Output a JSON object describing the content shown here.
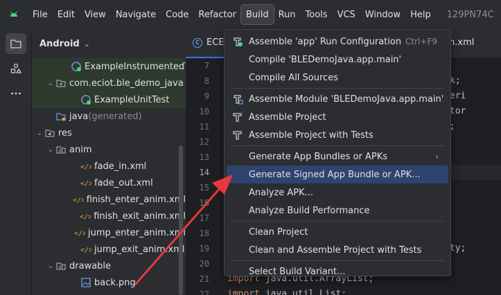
{
  "menubar": {
    "items": [
      "File",
      "Edit",
      "View",
      "Navigate",
      "Code",
      "Refactor",
      "Build",
      "Run",
      "Tools",
      "VCS",
      "Window",
      "Help"
    ],
    "active_index": 6,
    "project_name": "129PN74C"
  },
  "project_panel": {
    "title": "Android",
    "tree": [
      {
        "indent": 56,
        "arrow": "",
        "icon": "android-test-class-icon",
        "label": "ExampleInstrumentedT",
        "suffix": "",
        "hl": true
      },
      {
        "indent": 20,
        "arrow": "⌄",
        "icon": "package-icon",
        "label": "com.eciot.ble_demo_java",
        "suffix": "",
        "hl": true
      },
      {
        "indent": 56,
        "arrow": "",
        "icon": "android-test-class-icon",
        "label": "ExampleUnitTest",
        "suffix": "",
        "hl": true
      },
      {
        "indent": 20,
        "arrow": "",
        "icon": "folder-generated-icon",
        "label": "java",
        "suffix": " (generated)",
        "hl": false
      },
      {
        "indent": 4,
        "arrow": "⌄",
        "icon": "folder-res-icon",
        "label": "res",
        "suffix": "",
        "hl": false
      },
      {
        "indent": 20,
        "arrow": "⌄",
        "icon": "folder-icon",
        "label": "anim",
        "suffix": "",
        "hl": false
      },
      {
        "indent": 56,
        "arrow": "",
        "icon": "xml-file-icon",
        "label": "fade_in.xml",
        "suffix": "",
        "hl": false
      },
      {
        "indent": 56,
        "arrow": "",
        "icon": "xml-file-icon",
        "label": "fade_out.xml",
        "suffix": "",
        "hl": false
      },
      {
        "indent": 56,
        "arrow": "",
        "icon": "xml-file-icon",
        "label": "finish_enter_anim.xml",
        "suffix": "",
        "hl": false
      },
      {
        "indent": 56,
        "arrow": "",
        "icon": "xml-file-icon",
        "label": "finish_exit_anim.xml",
        "suffix": "",
        "hl": false
      },
      {
        "indent": 56,
        "arrow": "",
        "icon": "xml-file-icon",
        "label": "jump_enter_anim.xml",
        "suffix": "",
        "hl": false
      },
      {
        "indent": 56,
        "arrow": "",
        "icon": "xml-file-icon",
        "label": "jump_exit_anim.xml",
        "suffix": "",
        "hl": false
      },
      {
        "indent": 20,
        "arrow": "⌄",
        "icon": "folder-icon",
        "label": "drawable",
        "suffix": "",
        "hl": false
      },
      {
        "indent": 56,
        "arrow": "",
        "icon": "image-file-icon",
        "label": "back.png",
        "suffix": "",
        "hl": false
      }
    ]
  },
  "editor": {
    "tab_label": "ECE",
    "tab2_label": "n.xml",
    "line_numbers": [
      "7",
      "8",
      "9",
      "10",
      "11",
      "12",
      "13",
      "14",
      "15",
      "16",
      "17",
      "18",
      "19",
      "20",
      "21",
      "22"
    ],
    "current_line_index": 7,
    "code_lines": [
      "                                  ;",
      "                                  Callback;",
      "                                  Characteri",
      "                                  Descriptor",
      "                                  Service;",
      "                                  ile;",
      "",
      "                                  er;",
      "                                  r;",
      "",
      "",
      "",
      "                                  tActivity;",
      "                                  ;",
      "import java.util.ArrayList;",
      "import java.util.List;"
    ]
  },
  "build_menu": {
    "items": [
      {
        "type": "item",
        "icon": "assemble-run-config-icon",
        "label": "Assemble 'app' Run Configuration",
        "shortcut": "Ctrl+F9",
        "submenu": false,
        "selected": false
      },
      {
        "type": "item",
        "icon": "",
        "label": "Compile 'BLEDemoJava.app.main'",
        "shortcut": "",
        "submenu": false,
        "selected": false
      },
      {
        "type": "item",
        "icon": "",
        "label": "Compile All Sources",
        "shortcut": "",
        "submenu": false,
        "selected": false
      },
      {
        "type": "sep"
      },
      {
        "type": "item",
        "icon": "assemble-module-icon",
        "label": "Assemble Module 'BLEDemoJava.app.main'",
        "shortcut": "",
        "submenu": false,
        "selected": false
      },
      {
        "type": "item",
        "icon": "hammer-icon",
        "label": "Assemble Project",
        "shortcut": "",
        "submenu": false,
        "selected": false
      },
      {
        "type": "item",
        "icon": "hammer-icon",
        "label": "Assemble Project with Tests",
        "shortcut": "",
        "submenu": false,
        "selected": false
      },
      {
        "type": "sep"
      },
      {
        "type": "item",
        "icon": "",
        "label": "Generate App Bundles or APKs",
        "shortcut": "",
        "submenu": true,
        "selected": false
      },
      {
        "type": "item",
        "icon": "",
        "label": "Generate Signed App Bundle or APK...",
        "shortcut": "",
        "submenu": false,
        "selected": true
      },
      {
        "type": "item",
        "icon": "",
        "label": "Analyze APK...",
        "shortcut": "",
        "submenu": false,
        "selected": false
      },
      {
        "type": "item",
        "icon": "",
        "label": "Analyze Build Performance",
        "shortcut": "",
        "submenu": false,
        "selected": false
      },
      {
        "type": "sep"
      },
      {
        "type": "item",
        "icon": "",
        "label": "Clean Project",
        "shortcut": "",
        "submenu": false,
        "selected": false
      },
      {
        "type": "item",
        "icon": "",
        "label": "Clean and Assemble Project with Tests",
        "shortcut": "",
        "submenu": false,
        "selected": false
      },
      {
        "type": "sep"
      },
      {
        "type": "item",
        "icon": "",
        "label": "Select Build Variant...",
        "shortcut": "",
        "submenu": false,
        "selected": false
      }
    ]
  },
  "colors": {
    "accent": "#3574f0",
    "selection": "#2e436e",
    "annotation_arrow": "#e8383d",
    "android_green": "#3ddc84"
  }
}
